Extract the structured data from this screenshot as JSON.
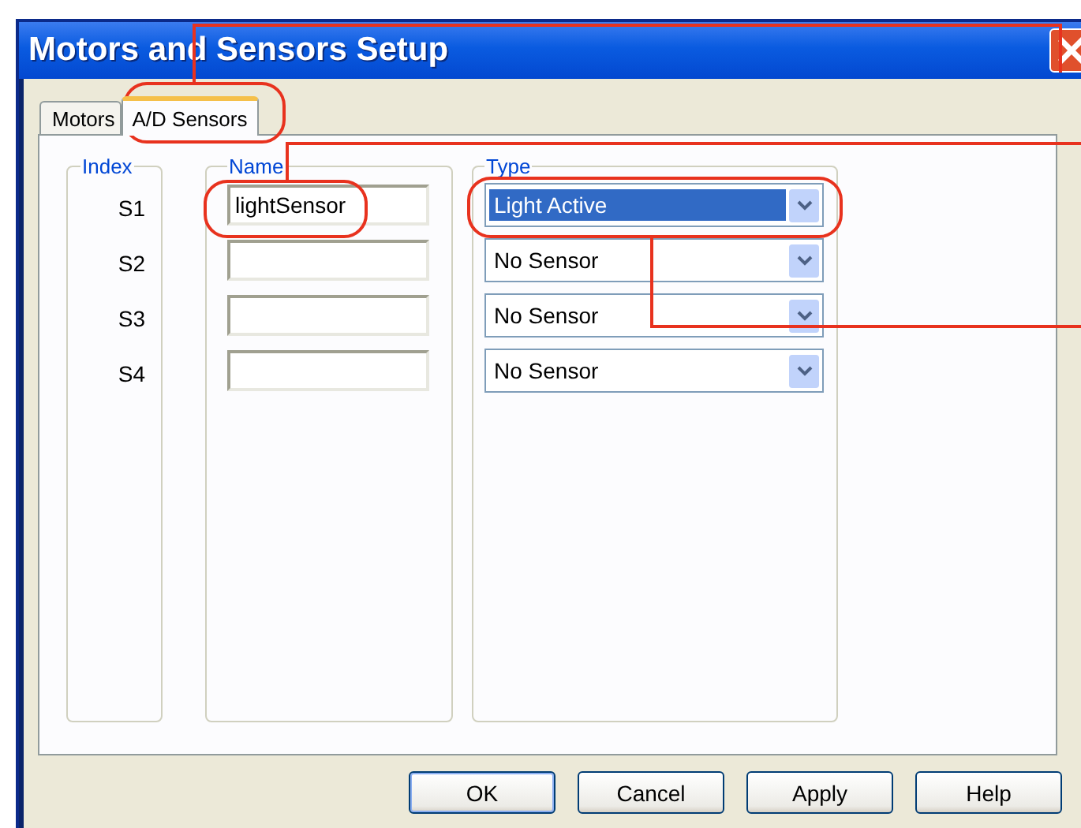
{
  "window": {
    "title": "Motors and Sensors Setup"
  },
  "tabs": [
    {
      "label": "Motors",
      "selected": false
    },
    {
      "label": "A/D Sensors",
      "selected": true
    }
  ],
  "groups": {
    "index": "Index",
    "name": "Name",
    "type": "Type"
  },
  "sensors": [
    {
      "index": "S1",
      "name": "lightSensor",
      "type": "Light Active",
      "highlighted": true
    },
    {
      "index": "S2",
      "type": "No Sensor",
      "highlighted": false
    },
    {
      "index": "S3",
      "type": "No Sensor",
      "highlighted": false
    },
    {
      "index": "S4",
      "type": "No Sensor",
      "highlighted": false
    }
  ],
  "buttons": [
    "OK",
    "Cancel",
    "Apply",
    "Help"
  ]
}
